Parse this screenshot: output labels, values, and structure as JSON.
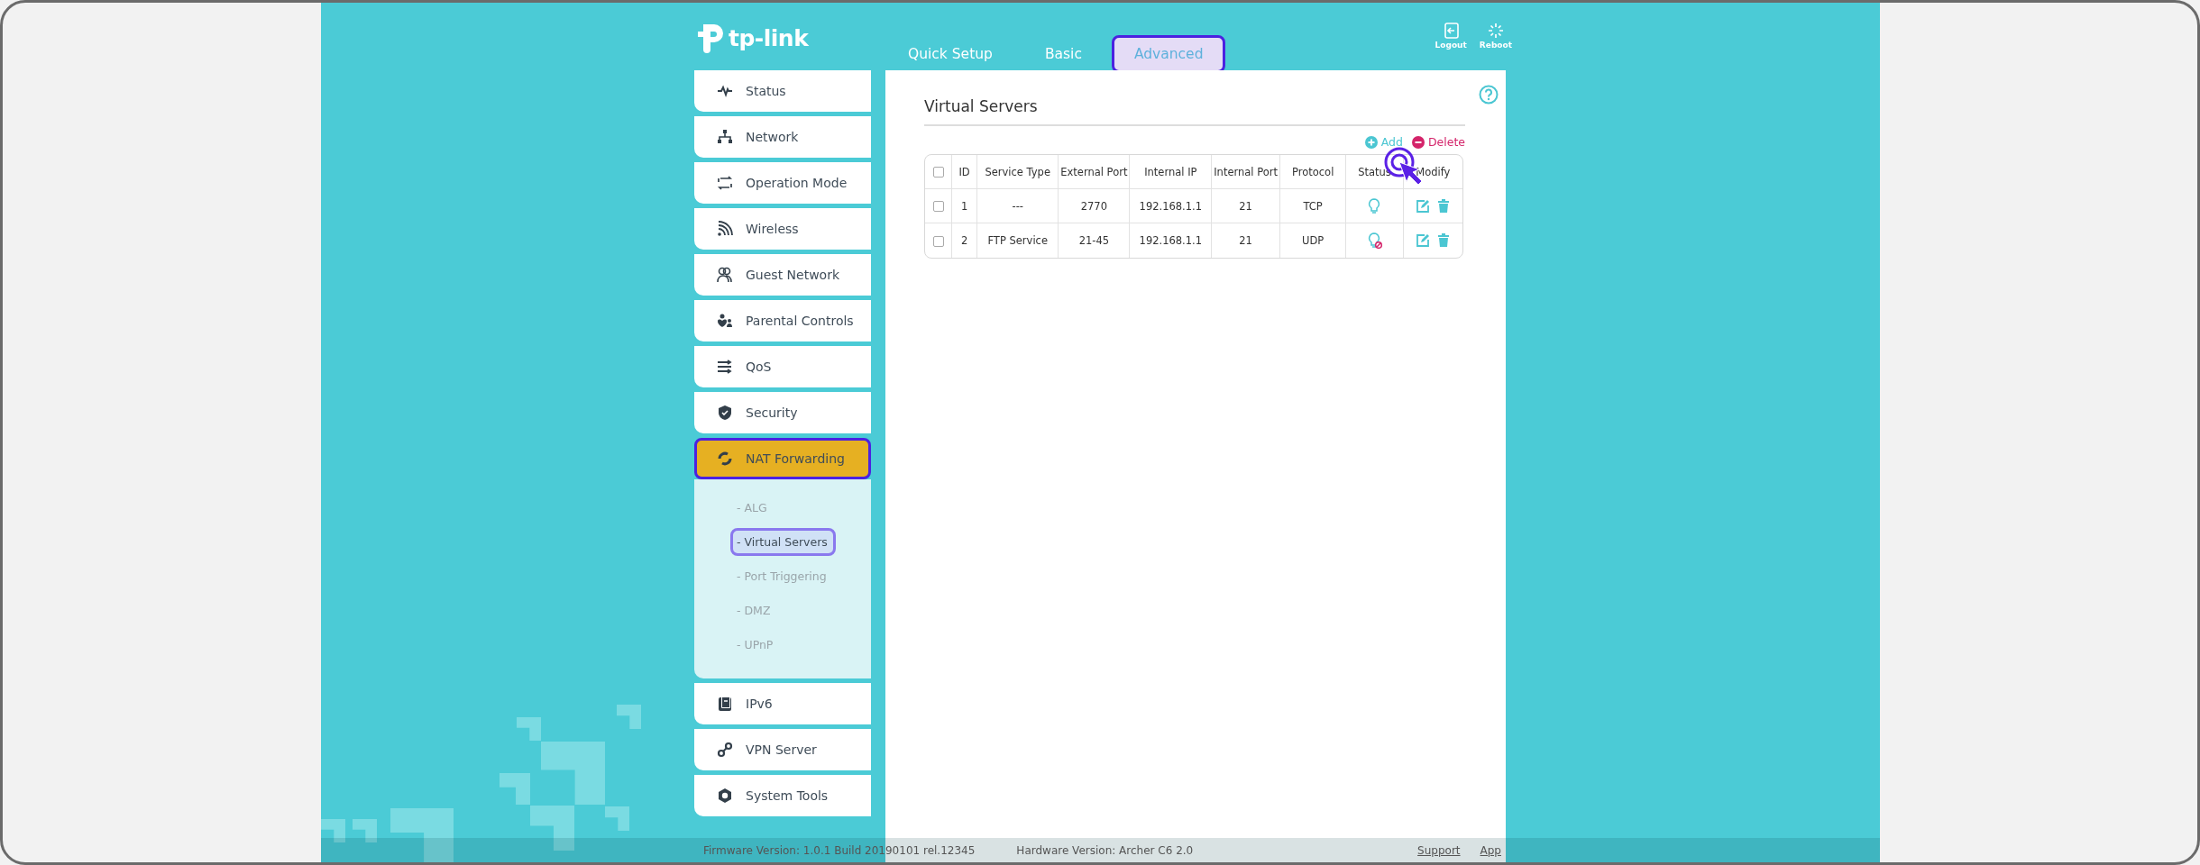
{
  "logo": {
    "text": "tp-link"
  },
  "tabs": [
    {
      "label": "Quick Setup",
      "selected": false,
      "highlighted": false
    },
    {
      "label": "Basic",
      "selected": false,
      "highlighted": false
    },
    {
      "label": "Advanced",
      "selected": true,
      "highlighted": true
    }
  ],
  "header_actions": [
    {
      "label": "Logout",
      "kind": "logout"
    },
    {
      "label": "Reboot",
      "kind": "reboot"
    }
  ],
  "sidebar": {
    "items": [
      {
        "label": "Status",
        "kind": "status",
        "selected": false,
        "highlighted": false
      },
      {
        "label": "Network",
        "kind": "network",
        "selected": false,
        "highlighted": false
      },
      {
        "label": "Operation Mode",
        "kind": "mode",
        "selected": false,
        "highlighted": false
      },
      {
        "label": "Wireless",
        "kind": "wireless",
        "selected": false,
        "highlighted": false
      },
      {
        "label": "Guest Network",
        "kind": "guest",
        "selected": false,
        "highlighted": false
      },
      {
        "label": "Parental Controls",
        "kind": "parental",
        "selected": false,
        "highlighted": false
      },
      {
        "label": "QoS",
        "kind": "qos",
        "selected": false,
        "highlighted": false
      },
      {
        "label": "Security",
        "kind": "security",
        "selected": false,
        "highlighted": false
      },
      {
        "label": "NAT Forwarding",
        "kind": "nat",
        "selected": true,
        "highlighted": true,
        "expanded": true,
        "children": [
          {
            "label": "- ALG",
            "selected": false,
            "highlighted": false
          },
          {
            "label": "- Virtual Servers",
            "selected": true,
            "highlighted": true
          },
          {
            "label": "- Port Triggering",
            "selected": false,
            "highlighted": false
          },
          {
            "label": "- DMZ",
            "selected": false,
            "highlighted": false
          },
          {
            "label": "- UPnP",
            "selected": false,
            "highlighted": false
          }
        ]
      },
      {
        "label": "IPv6",
        "kind": "ipv6",
        "selected": false,
        "highlighted": false
      },
      {
        "label": "VPN Server",
        "kind": "vpn",
        "selected": false,
        "highlighted": false
      },
      {
        "label": "System Tools",
        "kind": "tools",
        "selected": false,
        "highlighted": false
      }
    ]
  },
  "page": {
    "title": "Virtual Servers",
    "actions": [
      {
        "label": "Add",
        "kind": "add"
      },
      {
        "label": "Delete",
        "kind": "delete"
      }
    ],
    "table": {
      "all_checked": false,
      "columns": [
        "ID",
        "Service Type",
        "External Port",
        "Internal IP",
        "Internal Port",
        "Protocol",
        "Status",
        "Modify"
      ],
      "rows": [
        {
          "checked": false,
          "cells": [
            "1",
            "---",
            "2770",
            "192.168.1.1",
            "21",
            "TCP"
          ],
          "enabled": true
        },
        {
          "checked": false,
          "cells": [
            "2",
            "FTP Service",
            "21-45",
            "192.168.1.1",
            "21",
            "UDP"
          ],
          "enabled": false
        }
      ]
    }
  },
  "footer": {
    "firmware": "Firmware Version: 1.0.1 Build 20190101 rel.12345",
    "hardware": "Hardware Version: Archer C6 2.0",
    "links": [
      "Support",
      "App"
    ]
  }
}
